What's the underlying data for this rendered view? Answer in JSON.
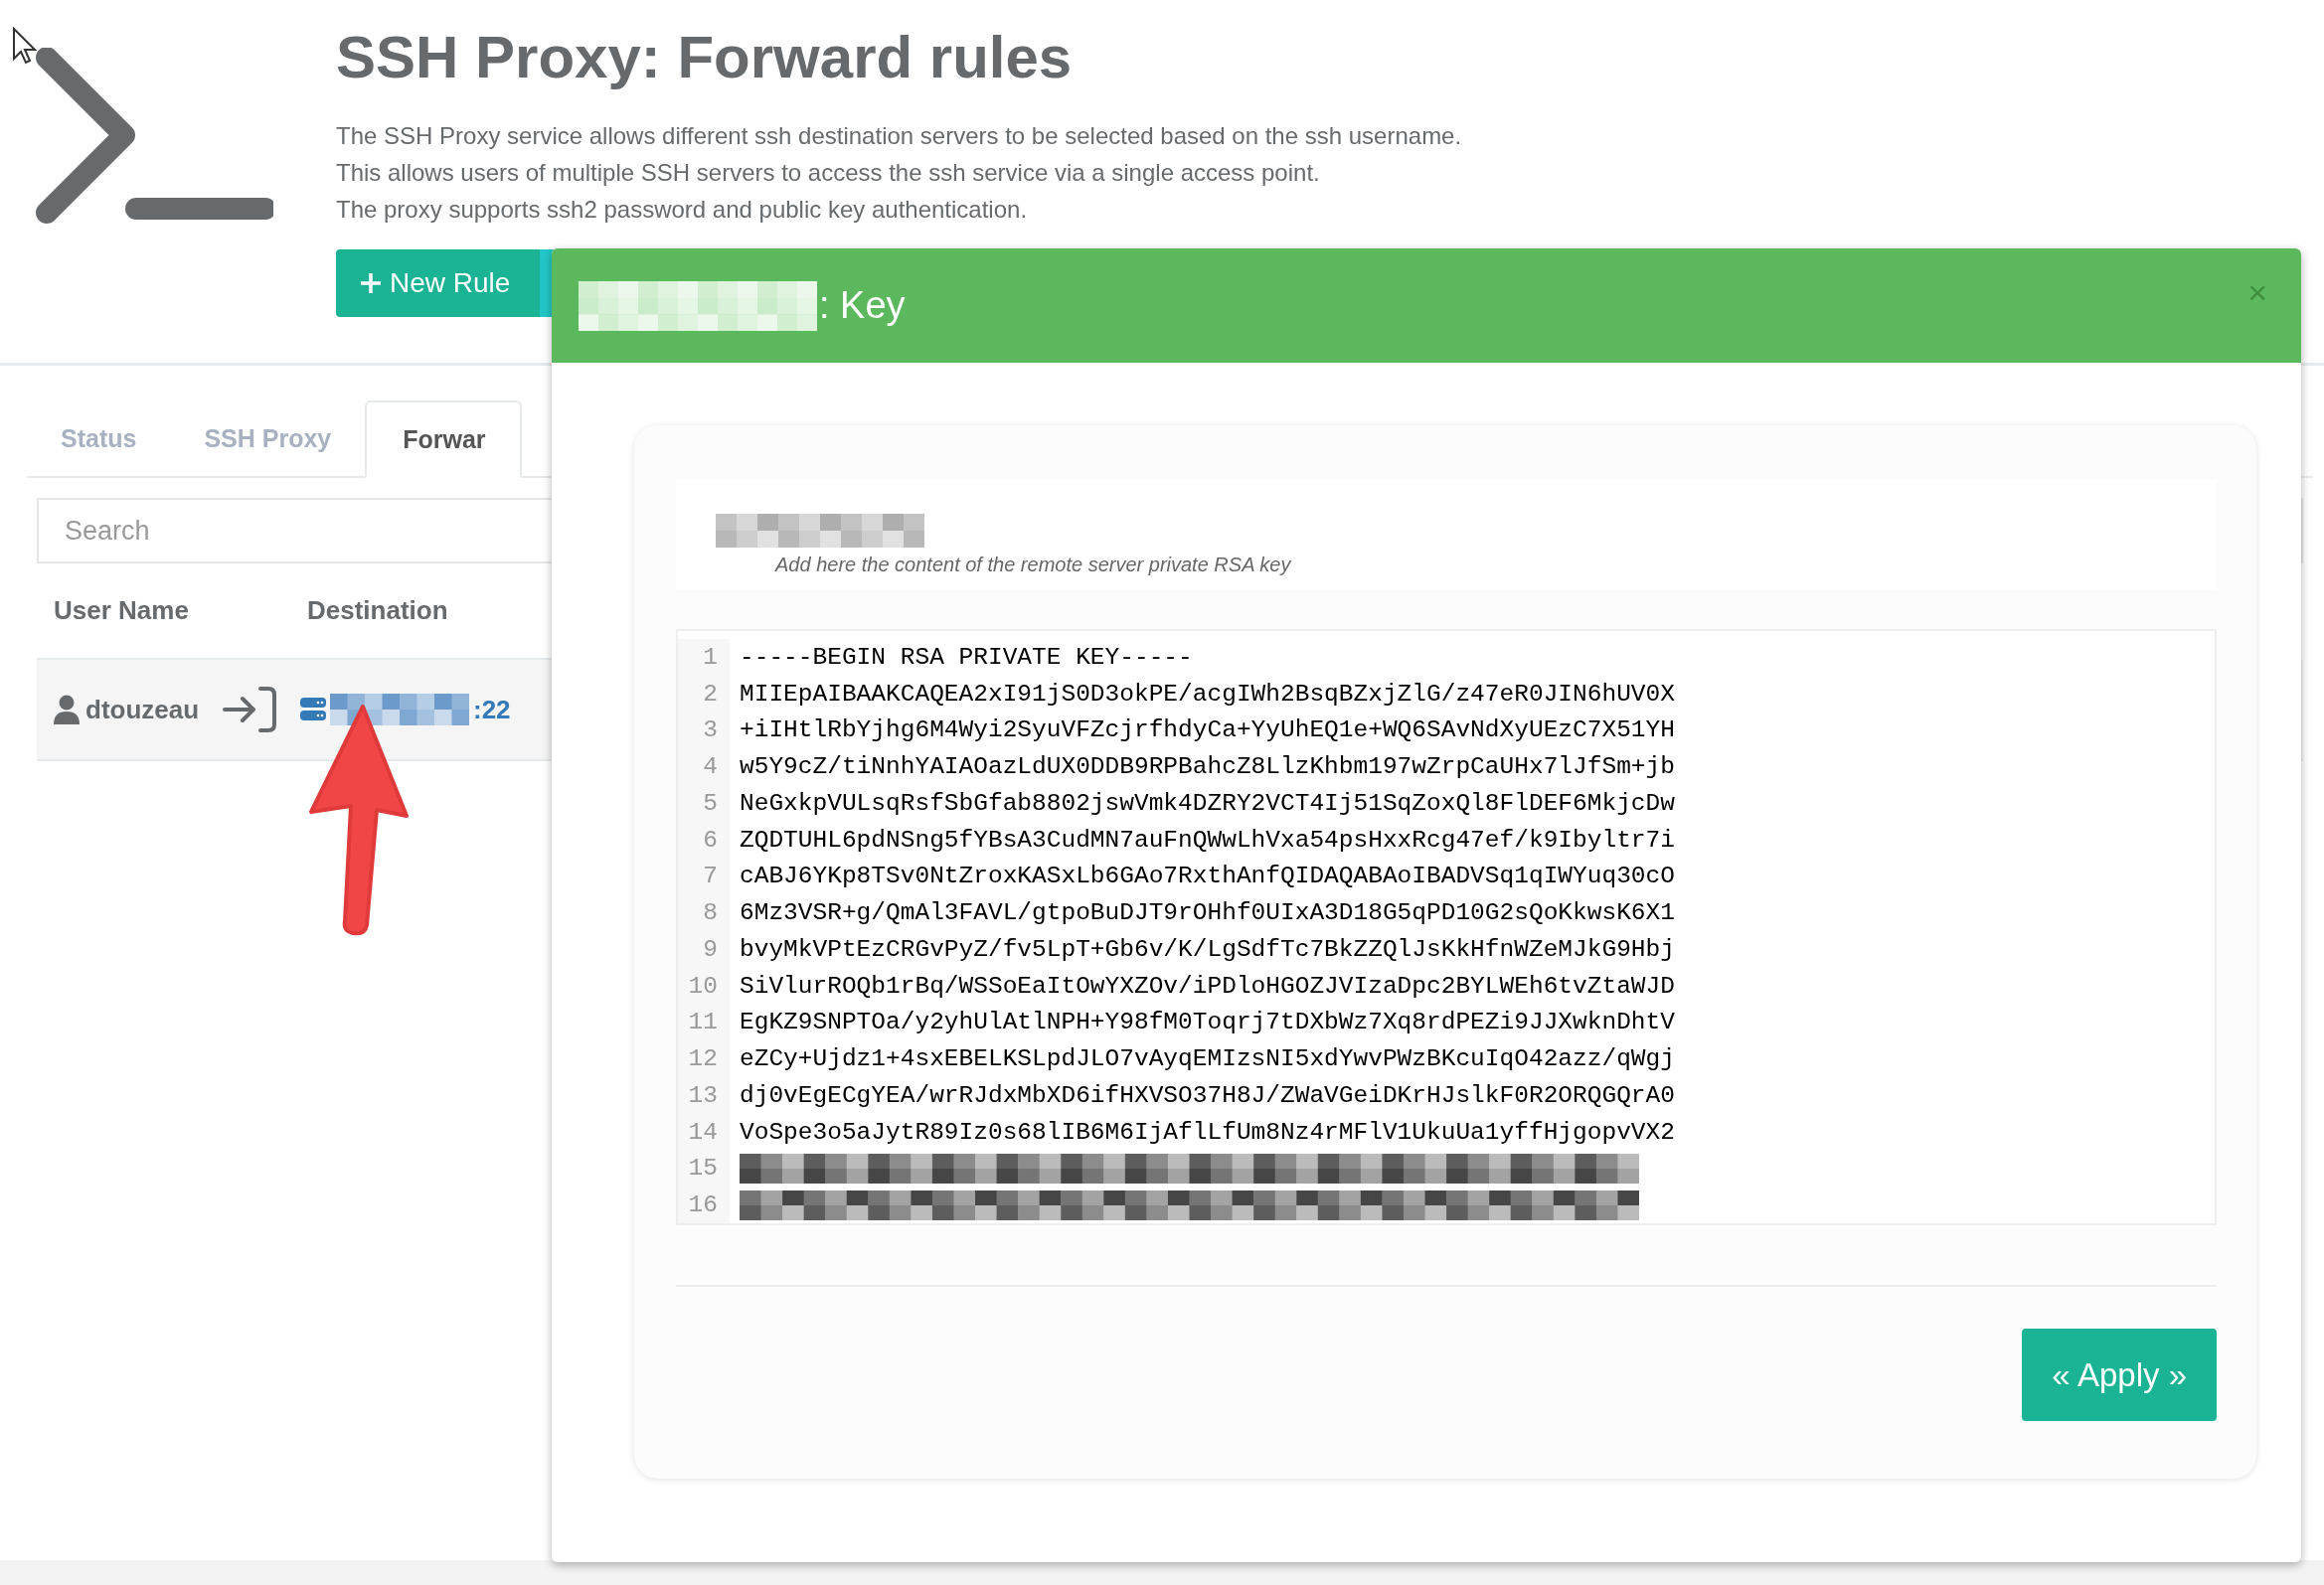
{
  "page": {
    "title": "SSH Proxy: Forward rules",
    "description": [
      "The SSH Proxy service allows different ssh destination servers to be selected based on the ssh username.",
      "This allows users of multiple SSH servers to access the ssh service via a single access point.",
      "The proxy supports ssh2 password and public key authentication."
    ],
    "new_rule_button": "New Rule"
  },
  "tabs": [
    {
      "label": "Status",
      "selected": false
    },
    {
      "label": "SSH Proxy",
      "selected": false
    },
    {
      "label": "Forwar",
      "selected": true
    }
  ],
  "search": {
    "placeholder": "Search"
  },
  "table": {
    "columns": [
      "User Name",
      "Destination"
    ],
    "rows": [
      {
        "user": "dtouzeau",
        "destination": ":22"
      }
    ]
  },
  "modal": {
    "title": ": Key",
    "close": "×",
    "help": "Add here the content of the remote server private RSA key",
    "lines": [
      {
        "number": "1",
        "kind": "text",
        "text": "-----BEGIN RSA PRIVATE KEY-----"
      },
      {
        "number": "2",
        "kind": "text",
        "text": "MIIEpAIBAAKCAQEA2xI91jS0D3okPE/acgIWh2BsqBZxjZlG/z47eR0JIN6hUV0X"
      },
      {
        "number": "3",
        "kind": "text",
        "text": "+iIHtlRbYjhg6M4Wyi2SyuVFZcjrfhdyCa+YyUhEQ1e+WQ6SAvNdXyUEzC7X51YH"
      },
      {
        "number": "4",
        "kind": "text",
        "text": "w5Y9cZ/tiNnhYAIAOazLdUX0DDB9RPBahcZ8LlzKhbm197wZrpCaUHx7lJfSm+jb"
      },
      {
        "number": "5",
        "kind": "text",
        "text": "NeGxkpVULsqRsfSbGfab8802jswVmk4DZRY2VCT4Ij51SqZoxQl8FlDEF6MkjcDw"
      },
      {
        "number": "6",
        "kind": "text",
        "text": "ZQDTUHL6pdNSng5fYBsA3CudMN7auFnQWwLhVxa54psHxxRcg47ef/k9Ibyltr7i"
      },
      {
        "number": "7",
        "kind": "text",
        "text": "cABJ6YKp8TSv0NtZroxKASxLb6GAo7RxthAnfQIDAQABAoIBADVSq1qIWYuq30cO"
      },
      {
        "number": "8",
        "kind": "text",
        "text": "6Mz3VSR+g/QmAl3FAVL/gtpoBuDJT9rOHhf0UIxA3D18G5qPD10G2sQoKkwsK6X1"
      },
      {
        "number": "9",
        "kind": "text",
        "text": "bvyMkVPtEzCRGvPyZ/fv5LpT+Gb6v/K/LgSdfTc7BkZZQlJsKkHfnWZeMJkG9Hbj"
      },
      {
        "number": "10",
        "kind": "text",
        "text": "SiVlurROQb1rBq/WSSoEaItOwYXZOv/iPDloHGOZJVIzaDpc2BYLWEh6tvZtaWJD"
      },
      {
        "number": "11",
        "kind": "text",
        "text": "EgKZ9SNPTOa/y2yhUlAtlNPH+Y98fM0Toqrj7tDXbWz7Xq8rdPEZi9JJXwknDhtV"
      },
      {
        "number": "12",
        "kind": "text",
        "text": "eZCy+Ujdz1+4sxEBELKSLpdJLO7vAyqEMIzsNI5xdYwvPWzBKcuIqO42azz/qWgj"
      },
      {
        "number": "13",
        "kind": "text",
        "text": "dj0vEgECgYEA/wrRJdxMbXD6ifHXVSO37H8J/ZWaVGeiDKrHJslkF0R2ORQGQrA0"
      },
      {
        "number": "14",
        "kind": "text",
        "text": "VoSpe3o5aJytR89Iz0s68lIB6M6IjAflLfUm8Nz4rMFlV1UkuUa1yffHjgopvVX2"
      },
      {
        "number": "15",
        "kind": "redacted"
      },
      {
        "number": "16",
        "kind": "redacted"
      }
    ],
    "apply_button": "« Apply »"
  }
}
